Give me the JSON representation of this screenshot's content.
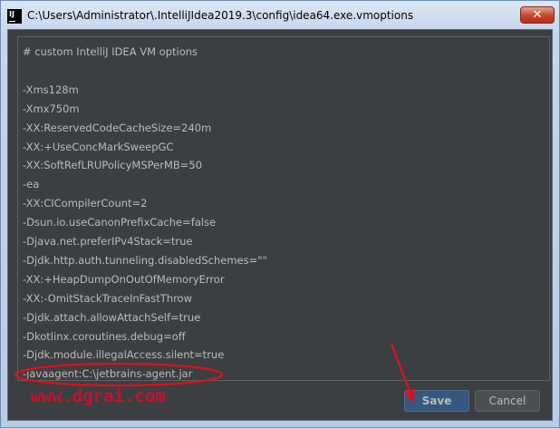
{
  "window": {
    "app_icon_text": "IJ",
    "title": "C:\\Users\\Administrator\\.IntelliJIdea2019.3\\config\\idea64.exe.vmoptions",
    "close_glyph": "✕"
  },
  "editor": {
    "lines": [
      "# custom IntelliJ IDEA VM options",
      "",
      "-Xms128m",
      "-Xmx750m",
      "-XX:ReservedCodeCacheSize=240m",
      "-XX:+UseConcMarkSweepGC",
      "-XX:SoftRefLRUPolicyMSPerMB=50",
      "-ea",
      "-XX:CICompilerCount=2",
      "-Dsun.io.useCanonPrefixCache=false",
      "-Djava.net.preferIPv4Stack=true",
      "-Djdk.http.auth.tunneling.disabledSchemes=\"\"",
      "-XX:+HeapDumpOnOutOfMemoryError",
      "-XX:-OmitStackTraceInFastThrow",
      "-Djdk.attach.allowAttachSelf=true",
      "-Dkotlinx.coroutines.debug=off",
      "-Djdk.module.illegalAccess.silent=true",
      "-javaagent:C:\\jetbrains-agent.jar"
    ]
  },
  "buttons": {
    "save": "Save",
    "cancel": "Cancel"
  },
  "watermark": "www.dgrai.com",
  "colors": {
    "editor_bg": "#3c3f41",
    "editor_text": "#bbbbbb",
    "save_bg": "#365880",
    "annotation_red": "#e0101e"
  }
}
